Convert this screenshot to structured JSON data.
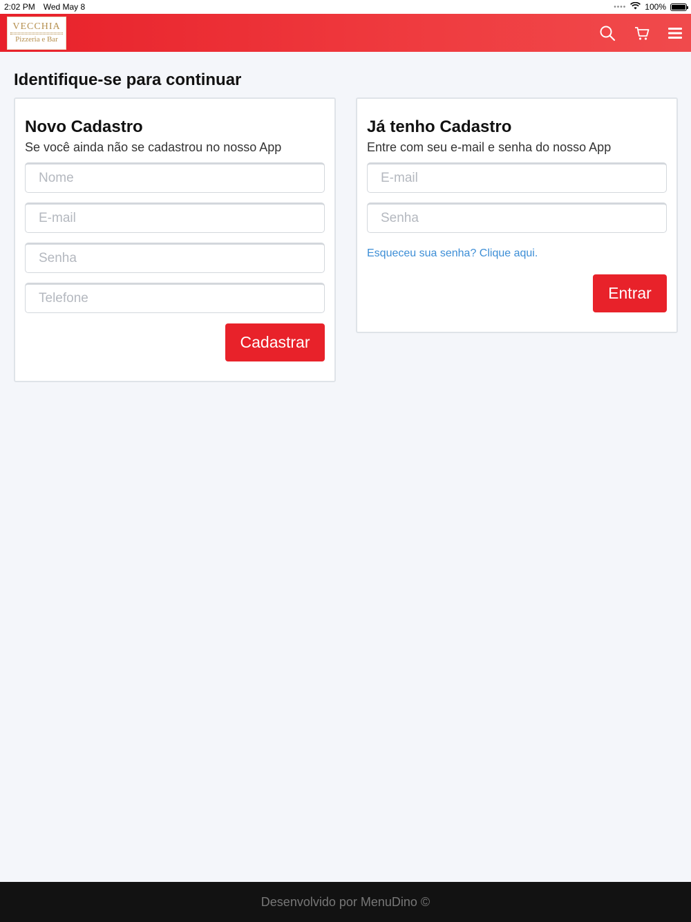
{
  "status_bar": {
    "time": "2:02 PM",
    "date": "Wed May 8",
    "battery": "100%"
  },
  "header": {
    "logo": {
      "line1": "VECCHIA",
      "line2": "Pizzeria e Bar"
    },
    "icons": [
      "search-icon",
      "cart-icon",
      "menu-icon"
    ],
    "accent_color": "#e8212a"
  },
  "page": {
    "title": "Identifique-se para continuar"
  },
  "register": {
    "title": "Novo Cadastro",
    "subtitle": "Se você ainda não se cadastrou no nosso App",
    "name_placeholder": "Nome",
    "email_placeholder": "E-mail",
    "password_placeholder": "Senha",
    "phone_placeholder": "Telefone",
    "submit_label": "Cadastrar"
  },
  "login": {
    "title": "Já tenho Cadastro",
    "subtitle": "Entre com seu e-mail e senha do nosso App",
    "email_placeholder": "E-mail",
    "password_placeholder": "Senha",
    "forgot_link": "Esqueceu sua senha? Clique aqui.",
    "submit_label": "Entrar"
  },
  "footer": {
    "text": "Desenvolvido por MenuDino ©"
  }
}
